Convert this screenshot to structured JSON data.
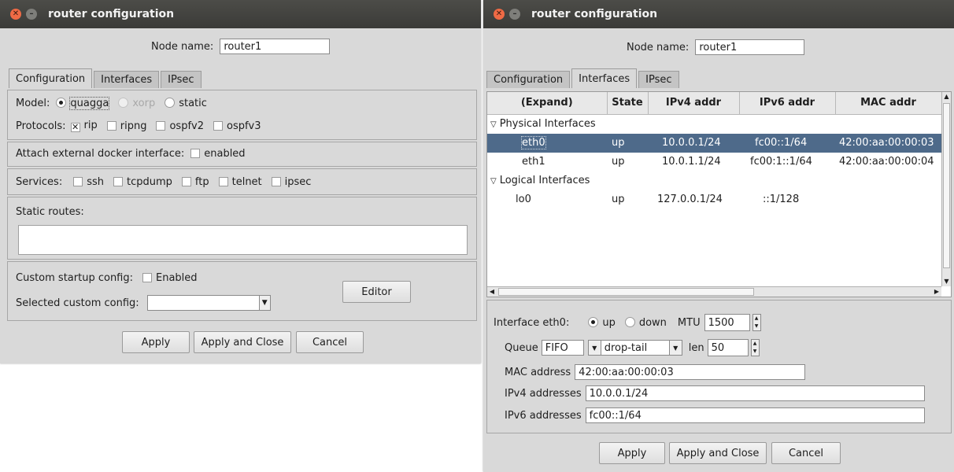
{
  "left": {
    "title": "router configuration",
    "node_name_label": "Node name:",
    "node_name_value": "router1",
    "tabs": [
      "Configuration",
      "Interfaces",
      "IPsec"
    ],
    "model_label": "Model:",
    "model_options": [
      "quagga",
      "xorp",
      "static"
    ],
    "protocols_label": "Protocols:",
    "protocols": [
      "rip",
      "ripng",
      "ospfv2",
      "ospfv3"
    ],
    "attach_label": "Attach external docker interface:",
    "attach_option": "enabled",
    "services_label": "Services:",
    "services": [
      "ssh",
      "tcpdump",
      "ftp",
      "telnet",
      "ipsec"
    ],
    "static_routes_label": "Static routes:",
    "custom_startup_label": "Custom startup config:",
    "custom_startup_option": "Enabled",
    "selected_custom_label": "Selected custom config:",
    "selected_custom_value": "",
    "editor_button": "Editor",
    "buttons": [
      "Apply",
      "Apply and Close",
      "Cancel"
    ]
  },
  "right": {
    "title": "router configuration",
    "node_name_label": "Node name:",
    "node_name_value": "router1",
    "tabs": [
      "Configuration",
      "Interfaces",
      "IPsec"
    ],
    "table": {
      "columns": [
        "(Expand)",
        "State",
        "IPv4 addr",
        "IPv6 addr",
        "MAC addr"
      ],
      "groups": {
        "physical": "Physical Interfaces",
        "logical": "Logical Interfaces"
      },
      "rows": {
        "eth0": [
          "eth0",
          "up",
          "10.0.0.1/24",
          "fc00::1/64",
          "42:00:aa:00:00:03"
        ],
        "eth1": [
          "eth1",
          "up",
          "10.0.1.1/24",
          "fc00:1::1/64",
          "42:00:aa:00:00:04"
        ],
        "lo0": [
          "lo0",
          "up",
          "127.0.0.1/24",
          "::1/128",
          ""
        ]
      }
    },
    "iface": {
      "label": "Interface eth0:",
      "state_up": "up",
      "state_down": "down",
      "mtu_label": "MTU",
      "mtu_value": "1500",
      "queue_label": "Queue",
      "queue_value": "FIFO",
      "drop_value": "drop-tail",
      "len_label": "len",
      "len_value": "50",
      "mac_label": "MAC address",
      "mac_value": "42:00:aa:00:00:03",
      "ipv4_label": "IPv4 addresses",
      "ipv4_value": "10.0.0.1/24",
      "ipv6_label": "IPv6 addresses",
      "ipv6_value": "fc00::1/64"
    },
    "buttons": [
      "Apply",
      "Apply and Close",
      "Cancel"
    ]
  }
}
